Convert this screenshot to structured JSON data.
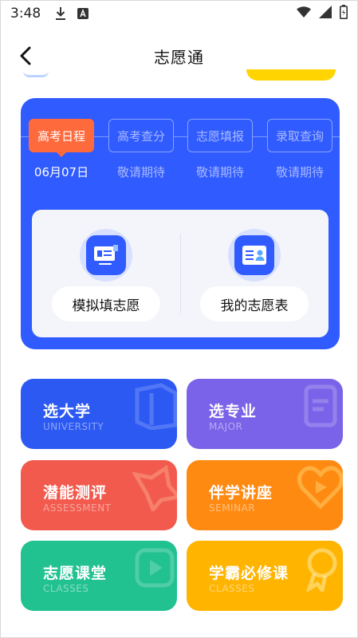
{
  "status_bar": {
    "time": "3:48",
    "icons": [
      "download-icon",
      "font-app-icon",
      "wifi-icon",
      "signal-icon",
      "battery-charging-icon"
    ]
  },
  "header": {
    "title": "志愿通",
    "back_icon": "chevron-left-icon"
  },
  "schedule": {
    "steps": [
      {
        "label": "高考日程",
        "sub": "06月07日",
        "active": true
      },
      {
        "label": "高考查分",
        "sub": "敬请期待",
        "active": false
      },
      {
        "label": "志愿填报",
        "sub": "敬请期待",
        "active": false
      },
      {
        "label": "录取查询",
        "sub": "敬请期待",
        "active": false
      }
    ]
  },
  "actions": [
    {
      "label": "模拟填志愿",
      "icon": "form-document-icon"
    },
    {
      "label": "我的志愿表",
      "icon": "profile-card-icon"
    }
  ],
  "tiles": [
    {
      "title": "选大学",
      "sub": "UNIVERSITY",
      "icon": "book-icon",
      "color": "#2d59f3"
    },
    {
      "title": "选专业",
      "sub": "MAJOR",
      "icon": "clipboard-icon",
      "color": "#7a63e8"
    },
    {
      "title": "潜能测评",
      "sub": "ASSESSMENT",
      "icon": "star-icon",
      "color": "#f25a4d"
    },
    {
      "title": "伴学讲座",
      "sub": "SEMINAR",
      "icon": "heart-play-icon",
      "color": "#ff8a12"
    },
    {
      "title": "志愿课堂",
      "sub": "CLASSES",
      "icon": "play-icon",
      "color": "#22c190"
    },
    {
      "title": "学霸必修课",
      "sub": "CLASSES",
      "icon": "medal-icon",
      "color": "#ffb400"
    }
  ],
  "colors": {
    "brand_blue": "#2f5bff",
    "active_step": "#ff6a3d",
    "peek_yellow": "#ffd400"
  }
}
